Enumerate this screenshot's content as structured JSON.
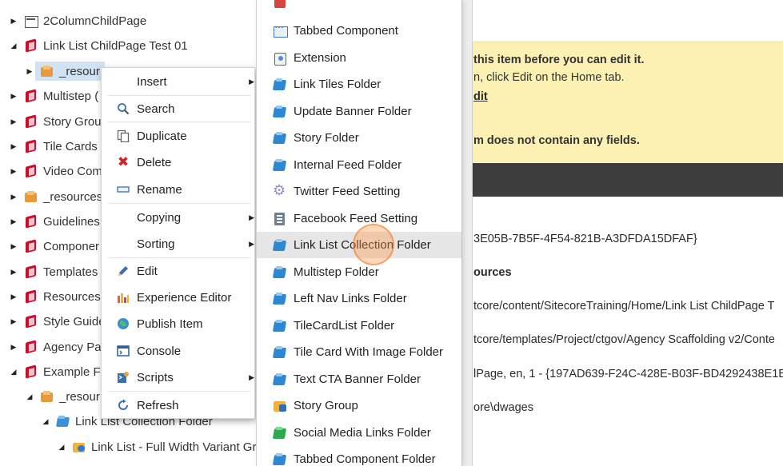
{
  "tree": [
    {
      "label": "2ColumnChildPage",
      "icon": "page-icon",
      "expanded": false
    },
    {
      "label": "Link List ChildPage Test 01",
      "icon": "red-book-icon",
      "expanded": true
    },
    {
      "label": "_resour",
      "icon": "resources-box-icon",
      "expanded": false,
      "selected": true
    },
    {
      "label": "Multistep (",
      "icon": "red-book-icon",
      "expanded": false
    },
    {
      "label": "Story Grou",
      "icon": "red-book-icon",
      "expanded": false
    },
    {
      "label": "Tile Cards",
      "icon": "red-book-icon",
      "expanded": false
    },
    {
      "label": "Video Com",
      "icon": "red-book-icon",
      "expanded": false
    },
    {
      "label": "_resources",
      "icon": "resources-box-icon",
      "expanded": false
    },
    {
      "label": "Guidelines",
      "icon": "red-book-icon",
      "expanded": false
    },
    {
      "label": "Componer",
      "icon": "red-book-icon",
      "expanded": false
    },
    {
      "label": "Templates",
      "icon": "red-book-icon",
      "expanded": false
    },
    {
      "label": "Resources",
      "icon": "red-book-icon",
      "expanded": false
    },
    {
      "label": "Style Guide",
      "icon": "red-book-icon",
      "expanded": false
    },
    {
      "label": "Agency Pa",
      "icon": "red-book-icon",
      "expanded": false
    },
    {
      "label": "Example F",
      "icon": "red-book-icon",
      "expanded": true
    },
    {
      "label": "_resour",
      "icon": "resources-box-icon",
      "expanded": true
    },
    {
      "label": "Link List Collection Folder",
      "icon": "folder-icon",
      "expanded": true
    },
    {
      "label": "Link List - Full Width Variant Gr",
      "icon": "link-list-icon",
      "expanded": true
    }
  ],
  "context_menu": {
    "items": [
      {
        "label": "Insert",
        "icon": "",
        "has_submenu": true
      },
      {
        "label": "Search",
        "icon": "search-icon",
        "has_submenu": false
      },
      {
        "label": "Duplicate",
        "icon": "duplicate-icon",
        "has_submenu": false
      },
      {
        "label": "Delete",
        "icon": "delete-icon",
        "has_submenu": false
      },
      {
        "label": "Rename",
        "icon": "rename-icon",
        "has_submenu": false
      },
      {
        "label": "Copying",
        "icon": "",
        "has_submenu": true
      },
      {
        "label": "Sorting",
        "icon": "",
        "has_submenu": true
      },
      {
        "label": "Edit",
        "icon": "pencil-icon",
        "has_submenu": false
      },
      {
        "label": "Experience Editor",
        "icon": "experience-editor-icon",
        "has_submenu": false
      },
      {
        "label": "Publish Item",
        "icon": "globe-icon",
        "has_submenu": false
      },
      {
        "label": "Console",
        "icon": "console-icon",
        "has_submenu": false
      },
      {
        "label": "Scripts",
        "icon": "scripts-icon",
        "has_submenu": true
      },
      {
        "label": "Refresh",
        "icon": "refresh-icon",
        "has_submenu": false
      }
    ]
  },
  "insert_submenu": {
    "items": [
      {
        "label": "Tabbed Component",
        "icon": "tabbed-component-icon"
      },
      {
        "label": "Extension",
        "icon": "extension-icon"
      },
      {
        "label": "Link Tiles Folder",
        "icon": "folder-icon"
      },
      {
        "label": "Update Banner Folder",
        "icon": "folder-icon"
      },
      {
        "label": "Story Folder",
        "icon": "folder-icon"
      },
      {
        "label": "Internal Feed Folder",
        "icon": "folder-icon"
      },
      {
        "label": "Twitter Feed Setting",
        "icon": "gear-icon"
      },
      {
        "label": "Facebook Feed Setting",
        "icon": "document-icon"
      },
      {
        "label": "Link List Collection Folder",
        "icon": "folder-icon",
        "highlighted": true
      },
      {
        "label": "Multistep Folder",
        "icon": "folder-icon"
      },
      {
        "label": "Left Nav Links Folder",
        "icon": "folder-icon"
      },
      {
        "label": "TileCardList Folder",
        "icon": "folder-icon"
      },
      {
        "label": "Tile Card With Image Folder",
        "icon": "folder-icon"
      },
      {
        "label": "Text CTA Banner Folder",
        "icon": "folder-icon"
      },
      {
        "label": "Story Group",
        "icon": "story-group-icon"
      },
      {
        "label": "Social Media Links Folder",
        "icon": "green-folder-icon"
      },
      {
        "label": "Tabbed Component Folder",
        "icon": "folder-icon"
      }
    ]
  },
  "content": {
    "warning_line1": "this item before you can edit it.",
    "warning_line2": "n, click Edit on the Home tab.",
    "warning_link": "dit",
    "warning_line3": "m does not contain any fields.",
    "item_id": "3E05B-7B5F-4F54-821B-A3DFDA15DFAF}",
    "item_name": "ources",
    "item_path": "tcore/content/SitecoreTraining/Home/Link List ChildPage T",
    "template_path": "tcore/templates/Project/ctgov/Agency Scaffolding v2/Conte",
    "version_info": "lPage, en, 1 - {197AD639-F24C-428E-B03F-BD4292438E1E}",
    "owner": "ore\\dwages"
  },
  "colors": {
    "warning_bg": "#fcf0b3",
    "dark_bar": "#3d3d3d",
    "selection": "#cfe3f5",
    "highlight": "#e6e6e6"
  }
}
